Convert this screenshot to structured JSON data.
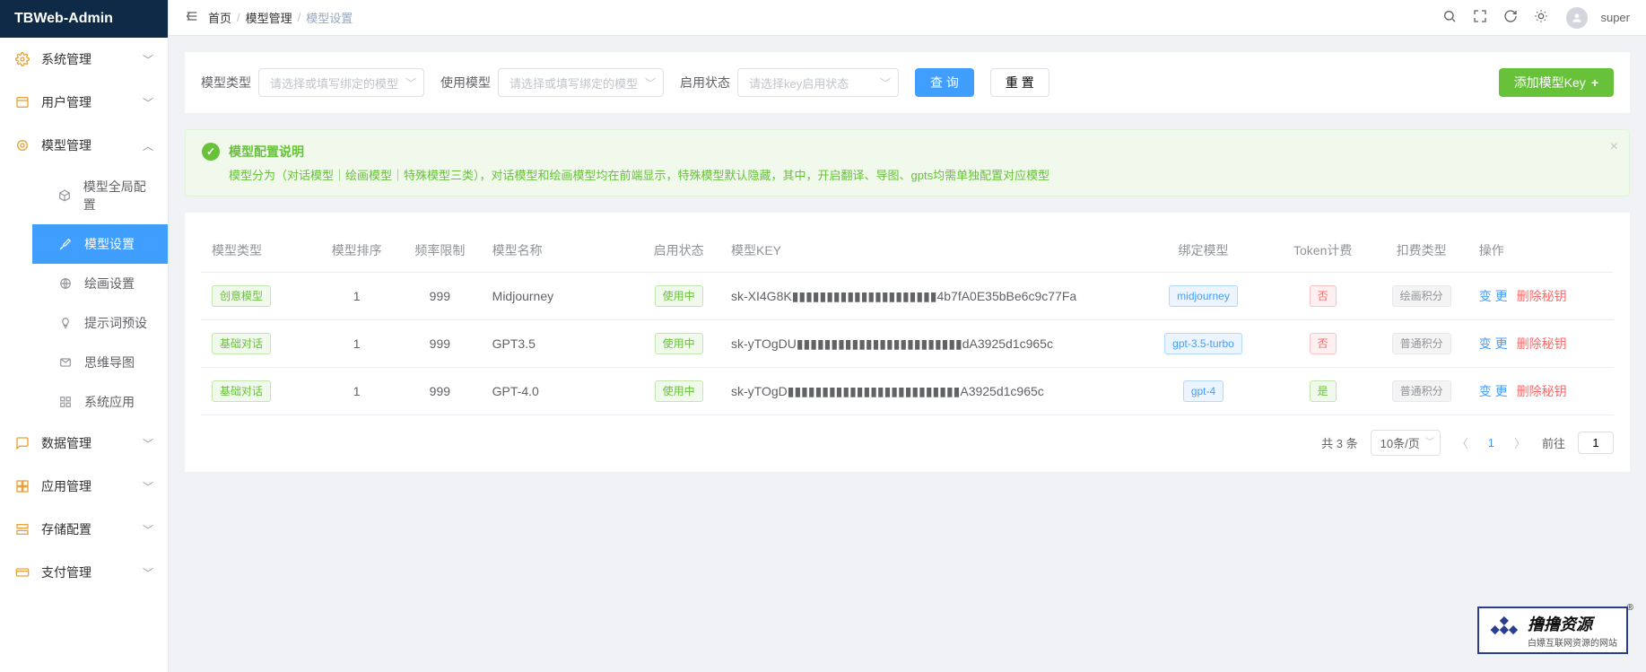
{
  "brand": "TBWeb-Admin",
  "sidebar": {
    "items": [
      {
        "label": "系统管理",
        "icon": "gear-icon",
        "expandable": true,
        "expanded": false
      },
      {
        "label": "用户管理",
        "icon": "users-icon",
        "expandable": true,
        "expanded": false
      },
      {
        "label": "模型管理",
        "icon": "model-icon",
        "expandable": true,
        "expanded": true,
        "children": [
          {
            "label": "模型全局配置",
            "icon": "cube-icon"
          },
          {
            "label": "模型设置",
            "icon": "brush-icon",
            "active": true
          },
          {
            "label": "绘画设置",
            "icon": "globe-icon"
          },
          {
            "label": "提示词预设",
            "icon": "bulb-icon"
          },
          {
            "label": "思维导图",
            "icon": "mindmap-icon"
          },
          {
            "label": "系统应用",
            "icon": "apps-icon"
          }
        ]
      },
      {
        "label": "数据管理",
        "icon": "chat-icon",
        "expandable": true,
        "expanded": false
      },
      {
        "label": "应用管理",
        "icon": "grid-icon",
        "expandable": true,
        "expanded": false
      },
      {
        "label": "存储配置",
        "icon": "storage-icon",
        "expandable": true,
        "expanded": false
      },
      {
        "label": "支付管理",
        "icon": "pay-icon",
        "expandable": true,
        "expanded": false
      }
    ]
  },
  "header": {
    "breadcrumb": [
      "首页",
      "模型管理",
      "模型设置"
    ],
    "user": "super"
  },
  "filters": {
    "model_type_label": "模型类型",
    "model_type_placeholder": "请选择或填写绑定的模型",
    "use_model_label": "使用模型",
    "use_model_placeholder": "请选择或填写绑定的模型",
    "status_label": "启用状态",
    "status_placeholder": "请选择key启用状态",
    "query_btn": "查 询",
    "reset_btn": "重 置",
    "add_btn": "添加模型Key"
  },
  "alert": {
    "title": "模型配置说明",
    "body": "模型分为（对话模型｜绘画模型｜特殊模型三类），对话模型和绘画模型均在前端显示，特殊模型默认隐藏，其中，开启翻译、导图、gpts均需单独配置对应模型"
  },
  "table": {
    "headers": {
      "type": "模型类型",
      "sort": "模型排序",
      "freq": "频率限制",
      "name": "模型名称",
      "status": "启用状态",
      "key": "模型KEY",
      "bind": "绑定模型",
      "token": "Token计费",
      "charge": "扣费类型",
      "action": "操作"
    },
    "rows": [
      {
        "type": "创意模型",
        "type_class": "green-o",
        "sort": 1,
        "freq": 999,
        "name": "Midjourney",
        "status": "使用中",
        "key": "sk-XI4G8K▮▮▮▮▮▮▮▮▮▮▮▮▮▮▮▮▮▮▮▮▮4b7fA0E35bBe6c9c77Fa",
        "bind": "midjourney",
        "token": "否",
        "token_class": "red",
        "charge": "绘画积分"
      },
      {
        "type": "基础对话",
        "type_class": "green-o",
        "sort": 1,
        "freq": 999,
        "name": "GPT3.5",
        "status": "使用中",
        "key": "sk-yTOgDU▮▮▮▮▮▮▮▮▮▮▮▮▮▮▮▮▮▮▮▮▮▮▮▮dA3925d1c965c",
        "bind": "gpt-3.5-turbo",
        "token": "否",
        "token_class": "red",
        "charge": "普通积分"
      },
      {
        "type": "基础对话",
        "type_class": "green-o",
        "sort": 1,
        "freq": 999,
        "name": "GPT-4.0",
        "status": "使用中",
        "key": "sk-yTOgD▮▮▮▮▮▮▮▮▮▮▮▮▮▮▮▮▮▮▮▮▮▮▮▮▮A3925d1c965c",
        "bind": "gpt-4",
        "token": "是",
        "token_class": "green",
        "charge": "普通积分"
      }
    ],
    "actions": {
      "edit": "变 更",
      "delete": "删除秘钥"
    }
  },
  "pager": {
    "total_text": "共 3 条",
    "page_size": "10条/页",
    "current": "1",
    "goto_label": "前往",
    "goto_value": "1"
  },
  "watermark": {
    "line1": "撸撸资源",
    "line2": "白嫖互联网资源的网站"
  }
}
